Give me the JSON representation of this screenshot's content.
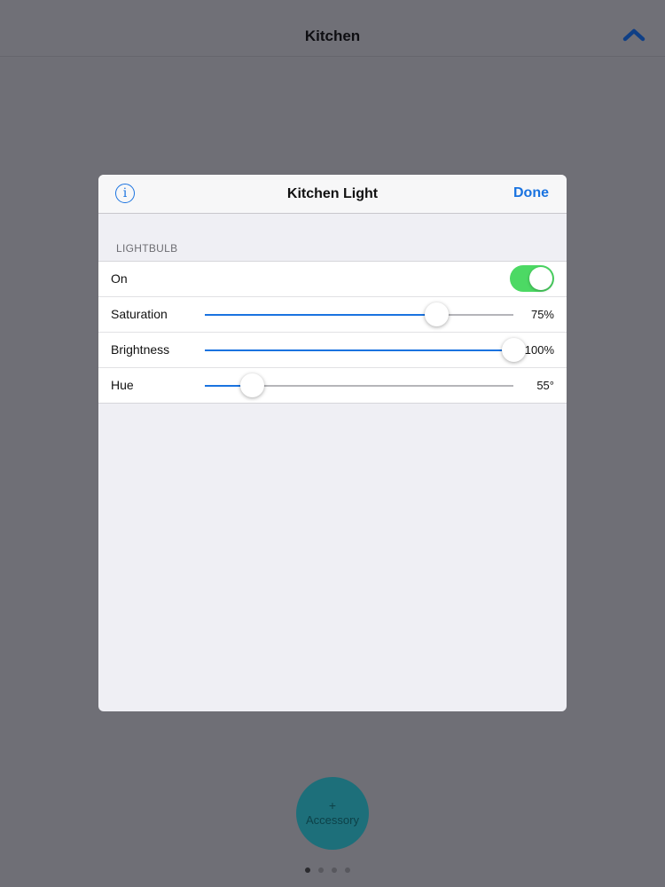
{
  "topbar": {
    "title": "Kitchen",
    "collapse_icon": "chevron-up-icon"
  },
  "modal": {
    "title": "Kitchen Light",
    "info_icon": "info-icon",
    "info_glyph": "i",
    "done_label": "Done",
    "section_header": "LIGHTBULB",
    "on": {
      "label": "On",
      "value": true
    },
    "saturation": {
      "label": "Saturation",
      "value": 75,
      "display": "75%"
    },
    "brightness": {
      "label": "Brightness",
      "value": 100,
      "display": "100%"
    },
    "hue": {
      "label": "Hue",
      "value": 55,
      "max": 360,
      "display": "55°"
    }
  },
  "accessory_button": {
    "plus": "+",
    "label": "Accessory"
  },
  "pager": {
    "count": 4,
    "active_index": 0
  },
  "colors": {
    "accent": "#1a73e0",
    "toggle_on": "#4cd964",
    "overlay_bg": "#6f6f76",
    "accessory": "#1d6f7a"
  }
}
